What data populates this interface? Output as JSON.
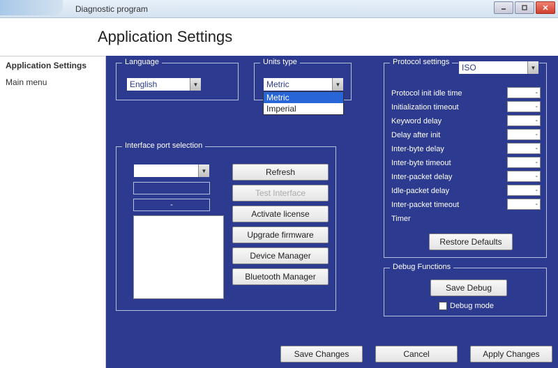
{
  "window": {
    "title": "Diagnostic program"
  },
  "header": {
    "title": "Application Settings"
  },
  "sidebar": {
    "items": [
      {
        "label": "Application Settings",
        "selected": true
      },
      {
        "label": "Main menu",
        "selected": false
      }
    ]
  },
  "language": {
    "legend": "Language",
    "value": "English"
  },
  "units": {
    "legend": "Units type",
    "value": "Metric",
    "options": [
      "Metric",
      "Imperial"
    ]
  },
  "protocol": {
    "legend": "Protocol settings",
    "value": "ISO",
    "rows": [
      {
        "label": "Protocol init idle time",
        "value": "-"
      },
      {
        "label": "Initialization timeout",
        "value": "-"
      },
      {
        "label": "Keyword delay",
        "value": "-"
      },
      {
        "label": "Delay after init",
        "value": "-"
      },
      {
        "label": "Inter-byte delay",
        "value": "-"
      },
      {
        "label": "Inter-byte timeout",
        "value": "-"
      },
      {
        "label": "Inter-packet delay",
        "value": "-"
      },
      {
        "label": "Idle-packet delay",
        "value": "-"
      },
      {
        "label": "Inter-packet timeout",
        "value": "-"
      },
      {
        "label": "Timer",
        "value": ""
      }
    ],
    "restore_label": "Restore Defaults"
  },
  "port": {
    "legend": "Interface port selection",
    "value": "",
    "dash": "-",
    "buttons": {
      "refresh": "Refresh",
      "test": "Test Interface",
      "activate": "Activate license",
      "upgrade": "Upgrade firmware",
      "devmgr": "Device Manager",
      "btmgr": "Bluetooth Manager"
    }
  },
  "debug": {
    "legend": "Debug Functions",
    "save_label": "Save Debug",
    "mode_label": "Debug mode"
  },
  "bottom": {
    "save": "Save Changes",
    "cancel": "Cancel",
    "apply": "Apply Changes"
  }
}
